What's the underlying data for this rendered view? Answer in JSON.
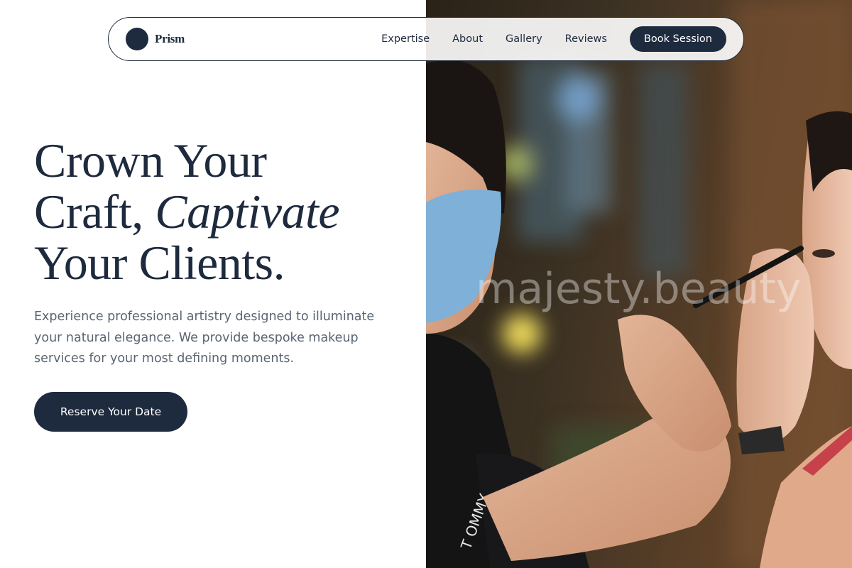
{
  "brand": {
    "name": "Prism"
  },
  "nav": {
    "links": [
      "Expertise",
      "About",
      "Gallery",
      "Reviews"
    ],
    "cta_label": "Book Session"
  },
  "hero": {
    "title_line1": "Crown Your",
    "title_line2_plain": "Craft, ",
    "title_line2_italic": "Captivate",
    "title_line3": "Your Clients.",
    "description": "Experience professional artistry designed to illuminate your natural elegance. We provide bespoke makeup services for your most defining moments.",
    "cta_label": "Reserve Your Date"
  },
  "photo": {
    "watermark": "majesty.beauty",
    "shirt_text": "T OMMY"
  },
  "colors": {
    "primary": "#1e2a3d",
    "body_text": "#5b6473",
    "background": "#ffffff"
  }
}
